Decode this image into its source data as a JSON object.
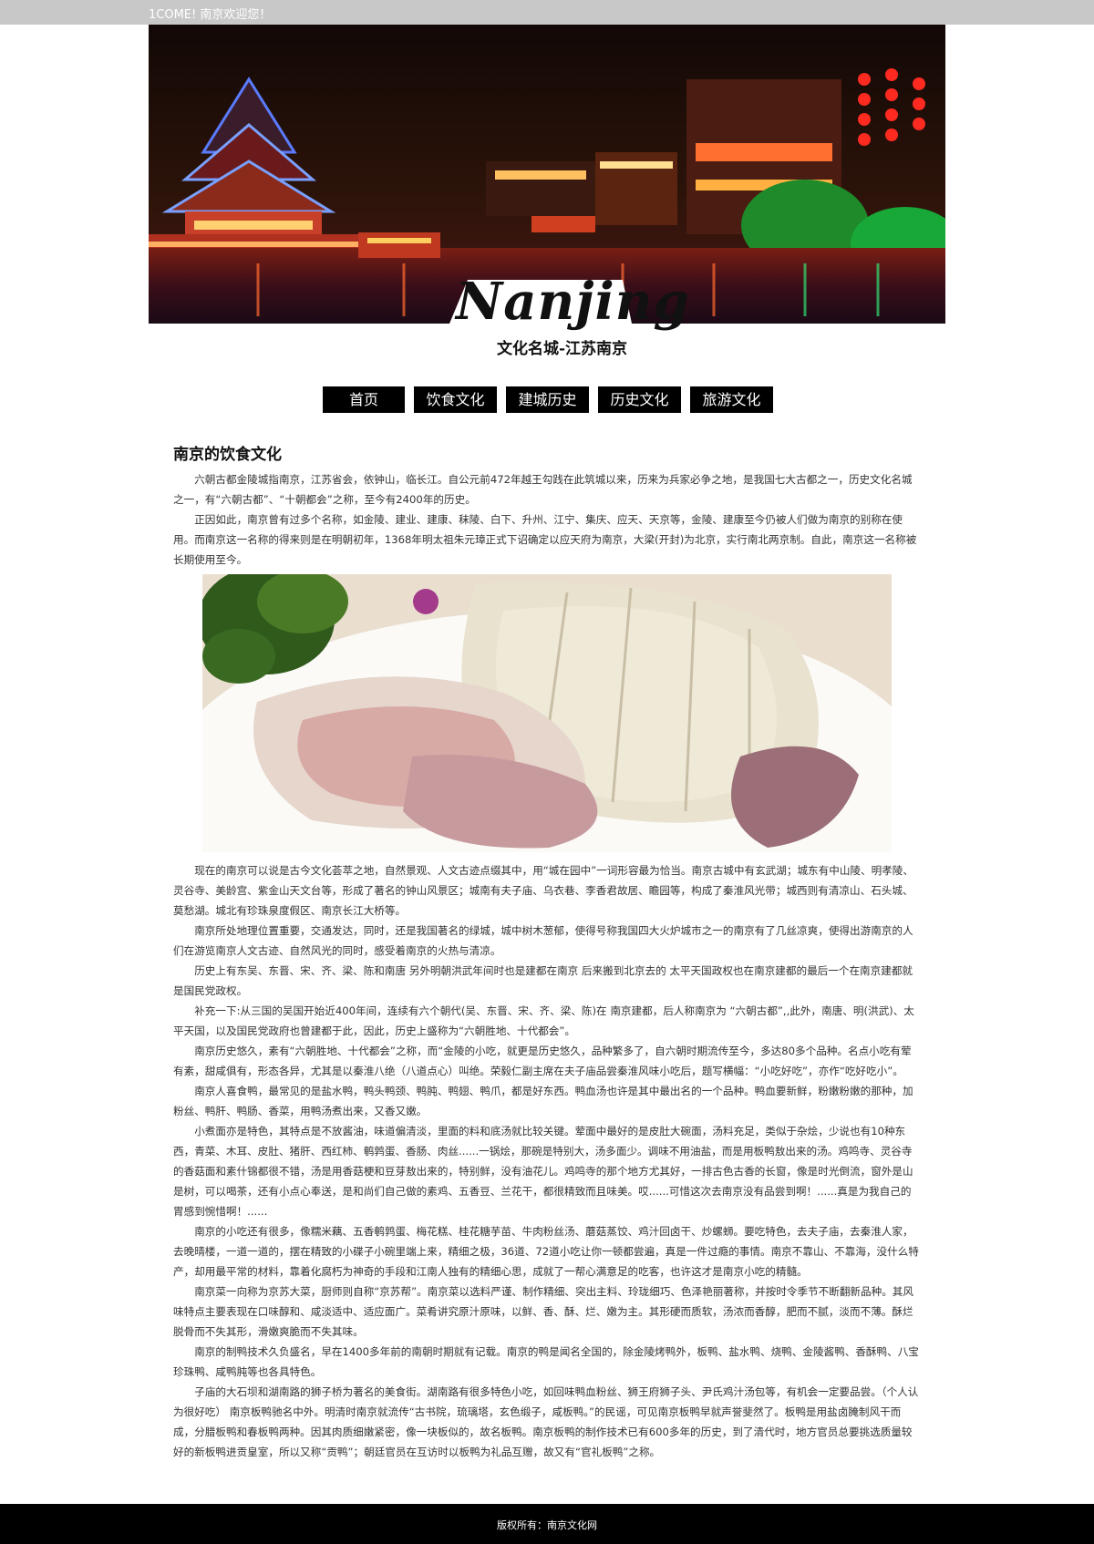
{
  "topbar": {
    "welcome": "1COME! 南京欢迎您！"
  },
  "logo": {
    "word": "Nanjing",
    "subtitle": "文化名城-江苏南京"
  },
  "nav": {
    "items": [
      "首页",
      "饮食文化",
      "建城历史",
      "历史文化",
      "旅游文化"
    ]
  },
  "article": {
    "title": "南京的饮食文化",
    "intro": [
      "六朝古都金陵城指南京，江苏省会，依钟山，临长江。自公元前472年越王勾践在此筑城以来，历来为兵家必争之地，是我国七大古都之一，历史文化名城之一，有“六朝古都”、“十朝都会”之称，至今有2400年的历史。",
      "正因如此，南京曾有过多个名称，如金陵、建业、建康、秣陵、白下、升州、江宁、集庆、应天、天京等，金陵、建康至今仍被人们做为南京的别称在使用。而南京这一名称的得来则是在明朝初年，1368年明太祖朱元璋正式下诏确定以应天府为南京，大梁(开封)为北京，实行南北两京制。自此，南京这一名称被长期使用至今。"
    ],
    "body": [
      "现在的南京可以说是古今文化荟萃之地，自然景观、人文古迹点缀其中，用“城在园中”一词形容最为恰当。南京古城中有玄武湖；城东有中山陵、明孝陵、灵谷寺、美龄宫、紫金山天文台等，形成了著名的钟山风景区；城南有夫子庙、乌衣巷、李香君故居、瞻园等，构成了秦淮风光带；城西则有清凉山、石头城、莫愁湖。城北有珍珠泉度假区、南京长江大桥等。",
      "南京所处地理位置重要，交通发达，同时，还是我国著名的绿城，城中树木葱郁，使得号称我国四大火炉城市之一的南京有了几丝凉爽，使得出游南京的人们在游览南京人文古迹、自然风光的同时，感受着南京的火热与清凉。",
      "历史上有东吴、东晋、宋、齐、梁、陈和南唐 另外明朝洪武年间时也是建都在南京 后来搬到北京去的 太平天国政权也在南京建都的最后一个在南京建都就是国民党政权。",
      "补充一下:从三国的吴国开始近400年间，连续有六个朝代(吴、东晋、宋、齐、梁、陈)在 南京建都，后人称南京为 “六朝古都”,,此外，南唐、明(洪武)、太平天国，以及国民党政府也曾建都于此，因此，历史上盛称为“六朝胜地、十代都会”。",
      "南京历史悠久，素有“六朝胜地、十代都会”之称，而“金陵的小吃，就更是历史悠久，品种繁多了，自六朝时期流传至今，多达80多个品种。名点小吃有荤有素，甜咸俱有，形态各异，尤其是以秦淮八绝（八道点心）叫绝。荣毅仁副主席在夫子庙品尝秦淮风味小吃后，题写横幅：“小吃好吃”，亦作“吃好吃小”。",
      "南京人喜食鸭，最常见的是盐水鸭，鸭头鸭颈、鸭肫、鸭翅、鸭爪，都是好东西。鸭血汤也许是其中最出名的一个品种。鸭血要新鲜，粉嫩粉嫩的那种，加粉丝、鸭肝、鸭肠、香菜，用鸭汤煮出来，又香又嫩。",
      "  小煮面亦是特色，其特点是不放酱油，味道偏清淡，里面的料和底汤就比较关键。荤面中最好的是皮肚大碗面，汤料充足，类似于杂烩，少说也有10种东西，青菜、木耳、皮肚、猪肝、西红柿、鹌鹑蛋、香肠、肉丝......一锅烩，那碗是特别大，汤多面少。调味不用油盐，而是用板鸭敖出来的汤。鸡鸣寺、灵谷寺的香菇面和素什锦都很不错，汤是用香菇梗和豆芽敖出来的，特别鲜，没有油花儿。鸡鸣寺的那个地方尤其好，一排古色古香的长窗，像是时光倒流，窗外是山是树，可以喝茶，还有小点心奉送，是和尚们自己做的素鸡、五香豆、兰花干，都很精致而且味美。哎......可惜这次去南京没有品尝到啊！......真是为我自己的胃感到惋惜啊！......",
      "南京的小吃还有很多，像糯米藕、五香鹌鹑蛋、梅花糕、桂花糖芋苗、牛肉粉丝汤、蘑菇蒸饺、鸡汁回卤干、炒螺蛳。要吃特色，去夫子庙，去秦淮人家，去晚晴楼，一道一道的，摆在精致的小碟子小碗里端上来，精细之极，36道、72道小吃让你一顿都尝遍，真是一件过瘾的事情。南京不靠山、不靠海，没什么特产，却用最平常的材料，靠着化腐朽为神奇的手段和江南人独有的精细心思，成就了一帮心满意足的吃客，也许这才是南京小吃的精髓。",
      "南京菜一向称为京苏大菜，厨师则自称“京苏帮”。南京菜以选料严谨、制作精细、突出主料、玲珑细巧、色泽艳丽著称，并按时令季节不断翻新品种。其风味特点主要表现在口味醇和、咸淡适中、适应面广。菜肴讲究原汁原味，以鲜、香、酥、烂、嫩为主。其形硬而质软，汤浓而香醇，肥而不腻，淡而不薄。酥烂脱骨而不失其形，滑嫩爽脆而不失其味。",
      "南京的制鸭技术久负盛名，早在1400多年前的南朝时期就有记载。南京的鸭是闻名全国的，除金陵烤鸭外，板鸭、盐水鸭、烧鸭、金陵酱鸭、香酥鸭、八宝珍珠鸭、咸鸭肫等也各具特色。",
      "子庙的大石坝和湖南路的狮子桥为著名的美食街。湖南路有很多特色小吃，如回味鸭血粉丝、狮王府狮子头、尹氏鸡汁汤包等，有机会一定要品尝。（个人认为很好吃） 南京板鸭驰名中外。明清时南京就流传“古书院，琉璃塔，玄色缎子，咸板鸭。”的民谣，可见南京板鸭早就声誉斐然了。板鸭是用盐卤腌制风干而成，分腊板鸭和春板鸭两种。因其肉质细嫩紧密，像一块板似的，故名板鸭。南京板鸭的制作技术已有600多年的历史，到了清代时，地方官员总要挑选质量较好的新板鸭进贡皇室，所以又称“贡鸭”；朝廷官员在互访时以板鸭为礼品互赠，故又有“官礼板鸭”之称。"
    ]
  },
  "footer": {
    "copyright": "版权所有：南京文化网"
  }
}
